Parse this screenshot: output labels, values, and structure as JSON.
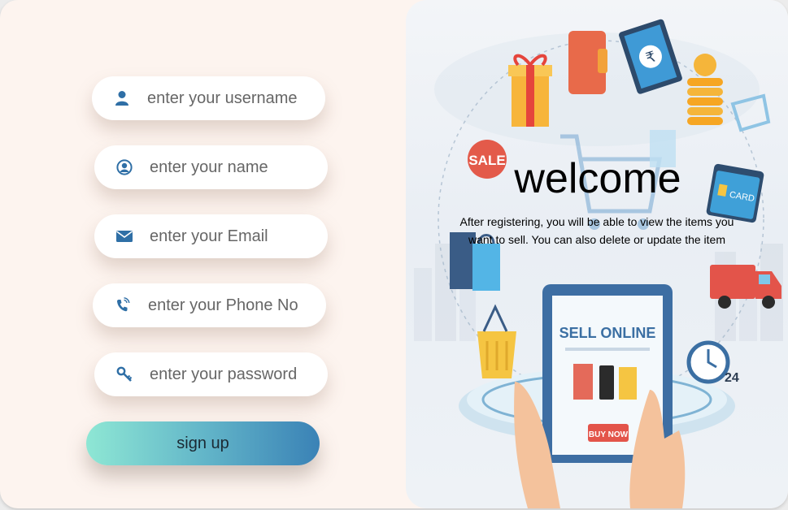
{
  "form": {
    "username_placeholder": "enter your username",
    "name_placeholder": "enter your name",
    "email_placeholder": "enter your Email",
    "phone_placeholder": "enter your Phone No",
    "password_placeholder": "enter your password",
    "signup_label": "sign up"
  },
  "hero": {
    "title": "welcome",
    "description": "After registering, you will be able to view the items you want to sell. You can also delete or update the item",
    "sale_tag": "SALE",
    "card_label": "CARD",
    "screen_title": "SELL ONLINE",
    "buy_button": "BUY NOW",
    "clock_number": "24"
  },
  "icons": {
    "username": "user-icon",
    "name": "user-circle-icon",
    "email": "envelope-icon",
    "phone": "phone-icon",
    "password": "key-icon"
  },
  "colors": {
    "background": "#fdf4ef",
    "icon": "#2f6fa6",
    "button_gradient_start": "#8ee7d4",
    "button_gradient_end": "#3a82b6"
  }
}
